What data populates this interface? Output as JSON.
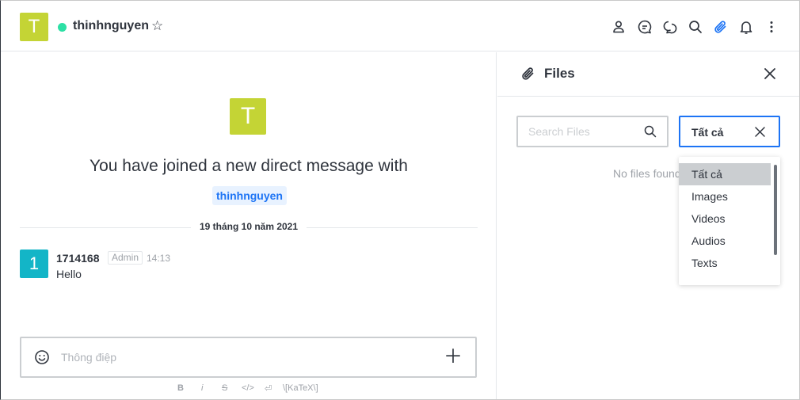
{
  "header": {
    "avatar_letter": "T",
    "room_name": "thinhnguyen",
    "status_color": "#2de0a5",
    "icons": [
      "user-info-icon",
      "discussion-icon",
      "threads-icon",
      "search-icon",
      "attachment-icon",
      "bell-icon",
      "kebab-menu-icon"
    ]
  },
  "main": {
    "avatar_letter": "T",
    "joined_text": "You have joined a new direct message with",
    "mention": "thinhnguyen",
    "date_divider": "19 tháng 10 năm 2021",
    "message": {
      "avatar_letter": "1",
      "username": "1714168",
      "role": "Admin",
      "time": "14:13",
      "text": "Hello"
    },
    "composer_placeholder": "Thông điệp",
    "formatting": {
      "bold": "B",
      "italic": "i",
      "strike": "S",
      "code": "</>",
      "multiline": "⏎",
      "katex": "\\[KaTeX\\]"
    }
  },
  "files_panel": {
    "title": "Files",
    "search_placeholder": "Search Files",
    "filter_value": "Tất cả",
    "no_files": "No files found",
    "options": [
      "Tất cả",
      "Images",
      "Videos",
      "Audios",
      "Texts"
    ],
    "selected_index": 0
  },
  "colors": {
    "accent": "#1d74f5",
    "avatar_t": "#c4d435",
    "avatar_1": "#13b5c7"
  }
}
